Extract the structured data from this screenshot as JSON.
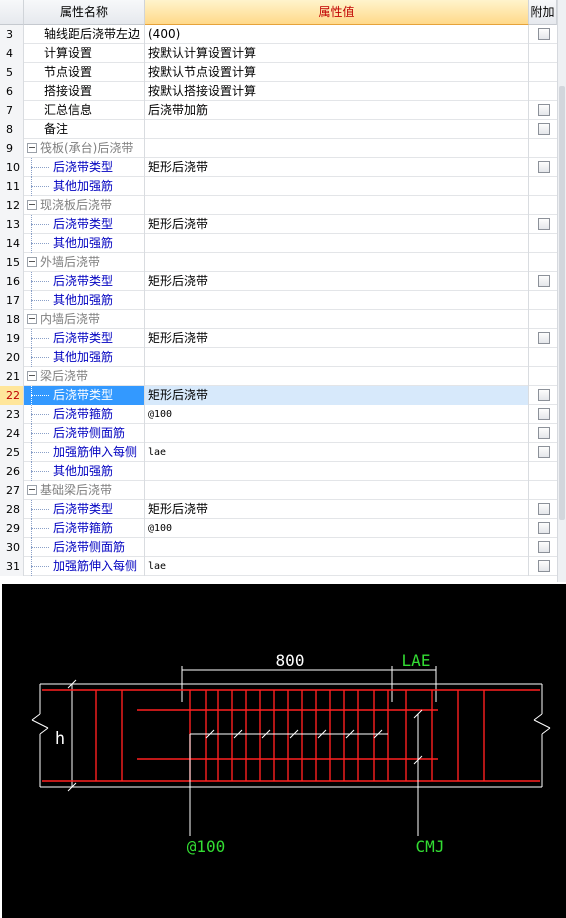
{
  "header": {
    "name_col": "属性名称",
    "value_col": "属性值",
    "extra_col": "附加"
  },
  "rows": [
    {
      "num": "3",
      "name": "轴线距后浇带左边",
      "value": "(400)",
      "kind": "plain",
      "check": true
    },
    {
      "num": "4",
      "name": "计算设置",
      "value": "按默认计算设置计算",
      "kind": "plain",
      "check": false
    },
    {
      "num": "5",
      "name": "节点设置",
      "value": "按默认节点设置计算",
      "kind": "plain",
      "check": false
    },
    {
      "num": "6",
      "name": "搭接设置",
      "value": "按默认搭接设置计算",
      "kind": "plain",
      "check": false
    },
    {
      "num": "7",
      "name": "汇总信息",
      "value": "后浇带加筋",
      "kind": "plain",
      "check": true
    },
    {
      "num": "8",
      "name": "备注",
      "value": "",
      "kind": "plain",
      "check": true
    },
    {
      "num": "9",
      "name": "筏板(承台)后浇带",
      "value": "",
      "kind": "group",
      "check": false
    },
    {
      "num": "10",
      "name": "后浇带类型",
      "value": "矩形后浇带",
      "kind": "child",
      "check": true
    },
    {
      "num": "11",
      "name": "其他加强筋",
      "value": "",
      "kind": "child",
      "check": false
    },
    {
      "num": "12",
      "name": "现浇板后浇带",
      "value": "",
      "kind": "group",
      "check": false
    },
    {
      "num": "13",
      "name": "后浇带类型",
      "value": "矩形后浇带",
      "kind": "child",
      "check": true
    },
    {
      "num": "14",
      "name": "其他加强筋",
      "value": "",
      "kind": "child",
      "check": false
    },
    {
      "num": "15",
      "name": "外墙后浇带",
      "value": "",
      "kind": "group",
      "check": false
    },
    {
      "num": "16",
      "name": "后浇带类型",
      "value": "矩形后浇带",
      "kind": "child",
      "check": true
    },
    {
      "num": "17",
      "name": "其他加强筋",
      "value": "",
      "kind": "child",
      "check": false
    },
    {
      "num": "18",
      "name": "内墙后浇带",
      "value": "",
      "kind": "group",
      "check": false
    },
    {
      "num": "19",
      "name": "后浇带类型",
      "value": "矩形后浇带",
      "kind": "child",
      "check": true
    },
    {
      "num": "20",
      "name": "其他加强筋",
      "value": "",
      "kind": "child",
      "check": false
    },
    {
      "num": "21",
      "name": "梁后浇带",
      "value": "",
      "kind": "group",
      "check": false
    },
    {
      "num": "22",
      "name": "后浇带类型",
      "value": "矩形后浇带",
      "kind": "child",
      "check": true,
      "selected": true
    },
    {
      "num": "23",
      "name": "后浇带箍筋",
      "value": "@100",
      "kind": "child",
      "check": true,
      "mono": true
    },
    {
      "num": "24",
      "name": "后浇带侧面筋",
      "value": "",
      "kind": "child",
      "check": true
    },
    {
      "num": "25",
      "name": "加强筋伸入每侧",
      "value": "lae",
      "kind": "child",
      "check": true,
      "mono": true
    },
    {
      "num": "26",
      "name": "其他加强筋",
      "value": "",
      "kind": "child",
      "check": false
    },
    {
      "num": "27",
      "name": "基础梁后浇带",
      "value": "",
      "kind": "group",
      "check": false
    },
    {
      "num": "28",
      "name": "后浇带类型",
      "value": "矩形后浇带",
      "kind": "child",
      "check": true
    },
    {
      "num": "29",
      "name": "后浇带箍筋",
      "value": "@100",
      "kind": "child",
      "check": true,
      "mono": true
    },
    {
      "num": "30",
      "name": "后浇带侧面筋",
      "value": "",
      "kind": "child",
      "check": true
    },
    {
      "num": "31",
      "name": "加强筋伸入每侧",
      "value": "lae",
      "kind": "child",
      "check": true,
      "mono": true
    }
  ],
  "drawing": {
    "dim_width": "800",
    "dim_lae": "LAE",
    "label_h": "h",
    "label_spacing": "@100",
    "label_cmj": "CMJ",
    "colors": {
      "rebar": "#ff2020",
      "green_text": "#33dd33",
      "white": "#ffffff",
      "background": "#000000"
    }
  }
}
